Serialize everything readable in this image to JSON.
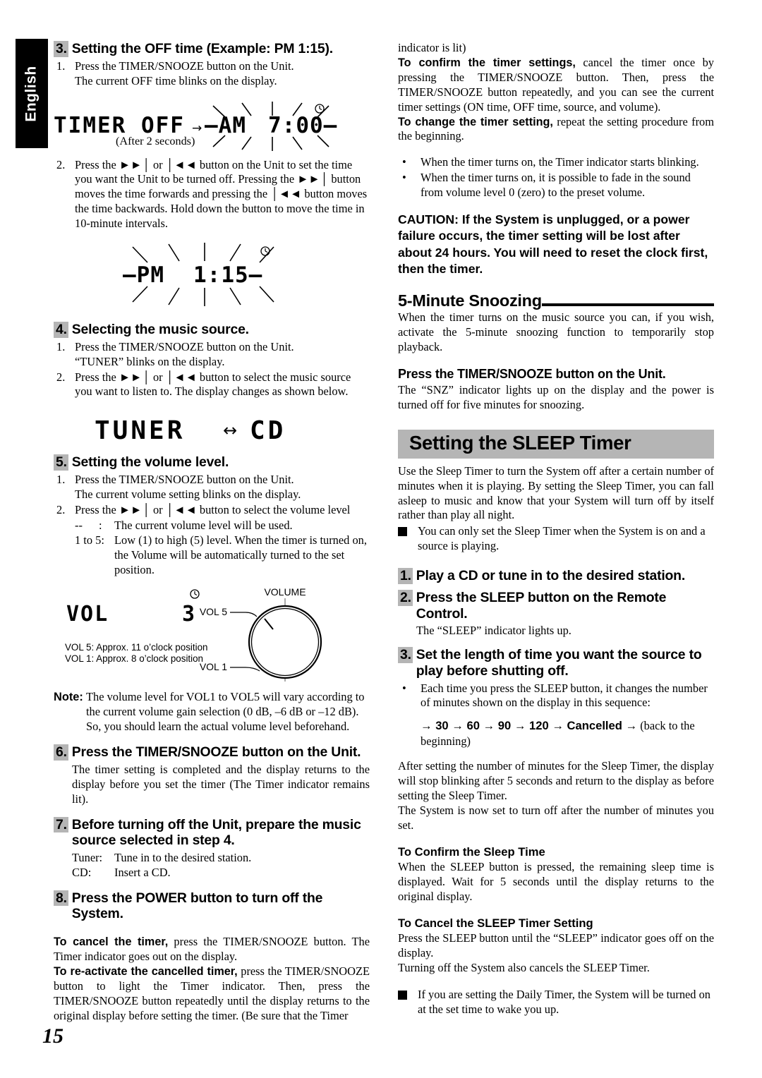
{
  "page": {
    "language_tab": "English",
    "page_number": "15"
  },
  "left": {
    "step3": {
      "num": "3.",
      "title": "Setting the OFF time (Example: PM 1:15).",
      "items": [
        {
          "n": "1.",
          "lines": [
            "Press the TIMER/SNOOZE button on the Unit.",
            "The current OFF time blinks on the display."
          ]
        },
        {
          "n": "2.",
          "lines": [
            "Press the ►►│ or │◄◄ button on the Unit to set the time you want the Unit to be turned off.",
            "Pressing the ►►│ button moves the time forwards and pressing the │◄◄ button moves the time backwards. Hold down the button to move the time in 10-minute intervals."
          ]
        }
      ],
      "display1": {
        "text": "TIMER OFF",
        "arrow": "→",
        "ampm": "AM",
        "time": "7:00",
        "caption": "(After 2 seconds)",
        "clock_icon": "clock-icon"
      },
      "display2": {
        "ampm": "PM",
        "time": "1:15",
        "clock_icon": "clock-icon"
      }
    },
    "step4": {
      "num": "4.",
      "title": "Selecting the music source.",
      "items": [
        {
          "n": "1.",
          "lines": [
            "Press the TIMER/SNOOZE button on the Unit.",
            "“TUNER” blinks on the display."
          ]
        },
        {
          "n": "2.",
          "lines": [
            "Press the ►►│ or │◄◄ button to select the music source you want to listen to.",
            "The display changes as shown below."
          ]
        }
      ],
      "display": {
        "left": "TUNER",
        "arrow": "↔",
        "right": "CD"
      }
    },
    "step5": {
      "num": "5.",
      "title": "Setting the volume level.",
      "items": [
        {
          "n": "1.",
          "lines": [
            "Press the TIMER/SNOOZE button on the Unit.",
            "The current volume setting blinks on the display."
          ]
        },
        {
          "n": "2.",
          "lines": [
            "Press the ►►│ or │◄◄ button to select the volume level"
          ]
        }
      ],
      "defs": [
        {
          "key": "--",
          "sep": ":",
          "value": "The current volume level will be used."
        },
        {
          "key": "1 to 5:",
          "sep": "",
          "value": "Low (1) to high (5) level. When the timer is turned on, the Volume will be automatically turned to the set position."
        }
      ],
      "display": {
        "label": "VOL",
        "value": "3",
        "clock_icon": "clock-icon"
      },
      "knob": {
        "title": "VOLUME",
        "label_high": "VOL 5",
        "label_low": "VOL 1"
      },
      "legend": [
        "VOL 5:  Approx. 11 o’clock position",
        "VOL 1:  Approx. 8 o’clock position"
      ],
      "note_label": "Note:",
      "note_text": "The volume level for VOL1 to VOL5 will vary according to the current volume gain selection (0 dB, –6 dB or –12 dB). So, you should learn the actual volume level beforehand."
    },
    "step6": {
      "num": "6.",
      "title": "Press the TIMER/SNOOZE button on the Unit.",
      "body": "The timer setting is completed and the display returns to the display before you set the timer (The Timer indicator remains lit)."
    },
    "step7": {
      "num": "7.",
      "title": "Before turning off the Unit, prepare the music source selected in step 4.",
      "rows": [
        {
          "k": "Tuner:",
          "v": "Tune in to the desired station."
        },
        {
          "k": "CD:",
          "v": "Insert a CD."
        }
      ]
    },
    "step8": {
      "num": "8.",
      "title": "Press the POWER button to turn off the System."
    },
    "cancel": {
      "bold1": "To cancel the timer,",
      "rest1": " press the TIMER/SNOOZE button. The Timer indicator goes out on the display.",
      "bold2": "To re-activate the cancelled timer,",
      "rest2": " press the TIMER/SNOOZE button to light the Timer indicator. Then, press the TIMER/SNOOZE button repeatedly until the display returns to the original display before setting the timer. (Be sure that the Timer"
    }
  },
  "right": {
    "continued": "indicator is lit)",
    "confirm": {
      "bold": "To confirm the timer settings,",
      "rest": " cancel the timer once by pressing the TIMER/SNOOZE button. Then, press the TIMER/SNOOZE button repeatedly, and you can see the current timer settings (ON time, OFF time, source, and volume)."
    },
    "change": {
      "bold": "To change the timer setting,",
      "rest": " repeat the setting procedure from the beginning."
    },
    "bullets": [
      "When the timer turns on, the Timer indicator starts blinking.",
      "When the timer turns on, it is possible to fade in the sound from volume level 0 (zero) to the preset volume."
    ],
    "caution": "CAUTION: If the System is unplugged, or a power failure occurs, the timer setting will be lost after about 24 hours. You will need to reset the clock first, then the timer.",
    "snooze": {
      "heading": "5-Minute Snoozing",
      "body": "When the timer turns on the music source you can, if you wish, activate the 5-minute snoozing function to temporarily stop playback.",
      "subhead": "Press the TIMER/SNOOZE button on the Unit.",
      "subbody": "The “SNZ” indicator lights up on the display and the power is turned off for five minutes for snoozing."
    },
    "sleep": {
      "banner": "Setting the SLEEP Timer",
      "intro": "Use the Sleep Timer to turn the System off after a certain number of minutes when it is playing. By setting the Sleep Timer, you can fall asleep to music and know that your System will turn off by itself rather than play all night.",
      "square_note": "You can only set the Sleep Timer when the System is on and a source is playing.",
      "steps": [
        {
          "num": "1.",
          "title": "Play a CD or tune in to the desired station."
        },
        {
          "num": "2.",
          "title": "Press the SLEEP button on the Remote Control."
        }
      ],
      "step2_body": "The “SLEEP” indicator lights up.",
      "step3": {
        "num": "3.",
        "title": "Set the length of time you want the source to play before shutting off."
      },
      "step3_bullet": "Each time you press the SLEEP button, it changes the number of minutes shown on the display in this sequence:",
      "sequence": "→ 30 → 60 → 90 → 120 → Cancelled →",
      "sequence_tail": " (back to the beginning)",
      "after": "After setting the number of minutes for the Sleep Timer, the display will stop blinking after 5 seconds and return to the display as before setting the Sleep Timer.",
      "after2": "The System is now set to turn off after the number of minutes you set.",
      "confirm_head": "To Confirm the Sleep Time",
      "confirm_body": "When the SLEEP button is pressed, the remaining sleep time is displayed. Wait for 5 seconds until the display returns to the original display.",
      "cancel_head": "To Cancel the SLEEP Timer Setting",
      "cancel_body": "Press the SLEEP button until the “SLEEP” indicator goes off on the display.",
      "cancel_body2": "Turning off the System also cancels the SLEEP Timer.",
      "final_note": "If you are setting the Daily Timer, the System will be turned on at the set time to wake you up."
    }
  }
}
